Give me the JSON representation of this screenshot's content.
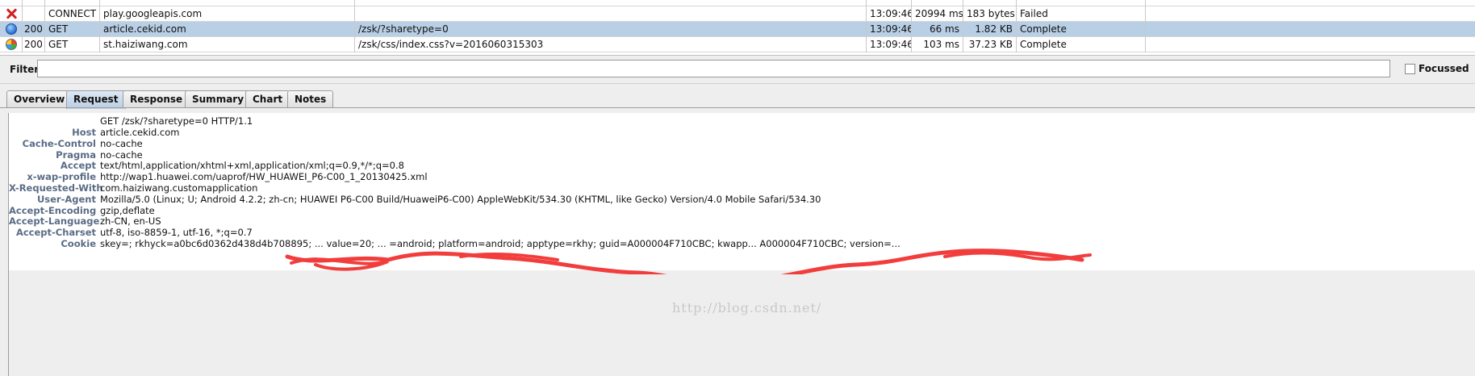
{
  "sessions": [
    {
      "icon": "failed-x-icon",
      "code": "",
      "method": "CONNECT",
      "host": "play.googleapis.com",
      "path": "",
      "time": "13:09:46",
      "duration": "20994 ms",
      "size": "183 bytes",
      "status": "Failed"
    },
    {
      "icon": "blue-globe-icon",
      "code": "200",
      "method": "GET",
      "host": "article.cekid.com",
      "path": "/zsk/?sharetype=0",
      "time": "13:09:46",
      "duration": "66 ms",
      "size": "1.82 KB",
      "status": "Complete",
      "selected": true
    },
    {
      "icon": "chrome-icon",
      "code": "200",
      "method": "GET",
      "host": "st.haiziwang.com",
      "path": "/zsk/css/index.css?v=2016060315303",
      "time": "13:09:46",
      "duration": "103 ms",
      "size": "37.23 KB",
      "status": "Complete"
    }
  ],
  "filter": {
    "label": "Filter:",
    "value": "",
    "focussed_label": "Focussed"
  },
  "tabs": [
    "Overview",
    "Request",
    "Response",
    "Summary",
    "Chart",
    "Notes"
  ],
  "request": {
    "request_line": "GET /zsk/?sharetype=0 HTTP/1.1",
    "headers": [
      {
        "name": "Host",
        "value": "article.cekid.com"
      },
      {
        "name": "Cache-Control",
        "value": "no-cache"
      },
      {
        "name": "Pragma",
        "value": "no-cache"
      },
      {
        "name": "Accept",
        "value": "text/html,application/xhtml+xml,application/xml;q=0.9,*/*;q=0.8"
      },
      {
        "name": "x-wap-profile",
        "value": "http://wap1.huawei.com/uaprof/HW_HUAWEI_P6-C00_1_20130425.xml"
      },
      {
        "name": "X-Requested-With",
        "value": "com.haiziwang.customapplication"
      },
      {
        "name": "User-Agent",
        "value": "Mozilla/5.0 (Linux; U; Android 4.2.2; zh-cn; HUAWEI P6-C00 Build/HuaweiP6-C00) AppleWebKit/534.30 (KHTML, like Gecko) Version/4.0 Mobile Safari/534.30"
      },
      {
        "name": "Accept-Encoding",
        "value": "gzip,deflate"
      },
      {
        "name": "Accept-Language",
        "value": "zh-CN, en-US"
      },
      {
        "name": "Accept-Charset",
        "value": "utf-8, iso-8859-1, utf-16, *;q=0.7"
      },
      {
        "name": "Cookie",
        "value": "skey=; rkhyck=a0bc6d0362d438d4b708895; ... value=20; ... =android; platform=android; apptype=rkhy; guid=A000004F710CBC; kwapp... A000004F710CBC; version=..."
      }
    ]
  },
  "watermark": "http://blog.csdn.net/"
}
